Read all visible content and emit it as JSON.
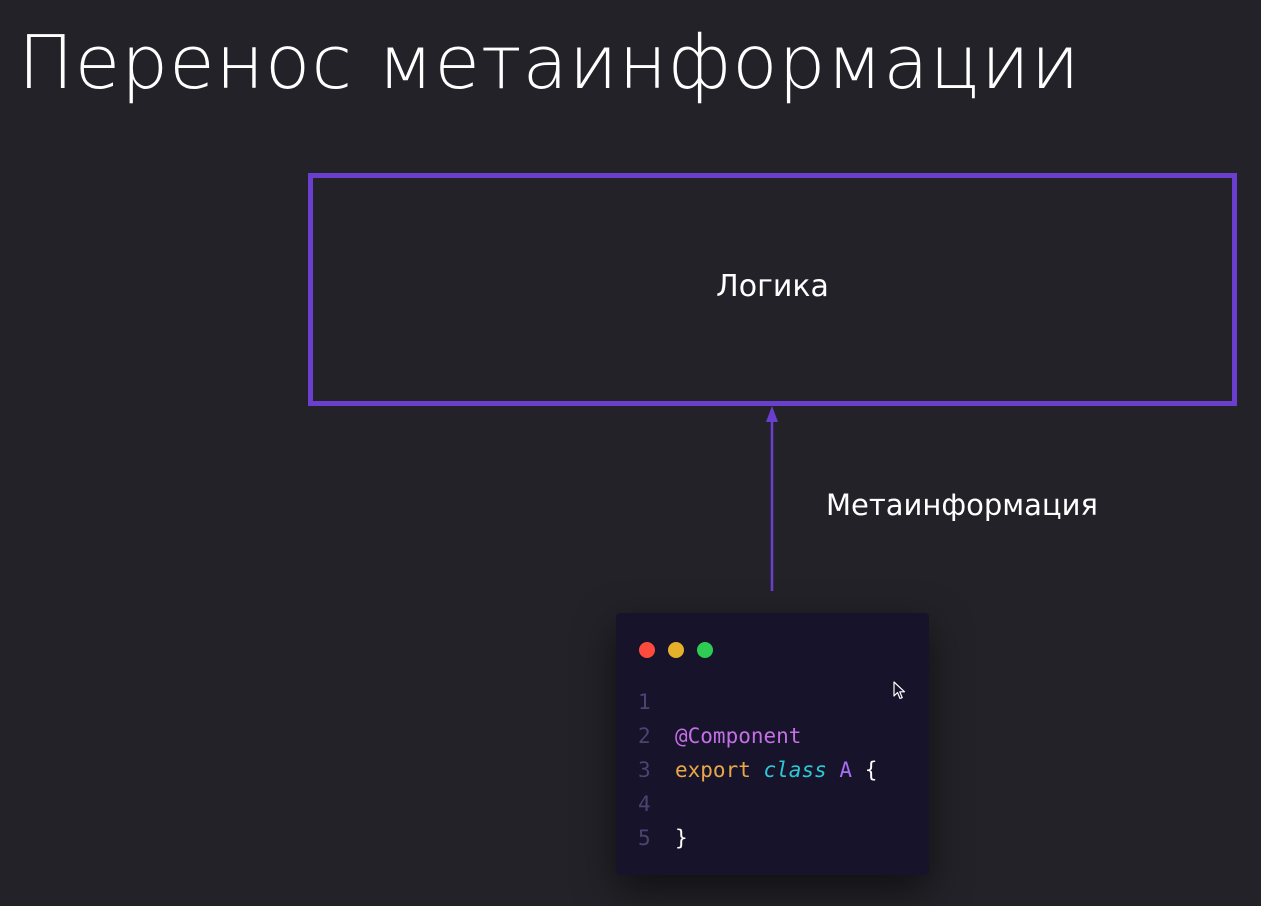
{
  "slide": {
    "title": "Перенос метаинформации"
  },
  "diagram": {
    "logic_box_label": "Логика",
    "arrow_label": "Метаинформация",
    "colors": {
      "accent": "#6a3fd0",
      "background": "#232228",
      "code_background": "#16132b"
    }
  },
  "code_window": {
    "dots": [
      {
        "name": "close",
        "color": "#ff4a3d"
      },
      {
        "name": "minimize",
        "color": "#e5b12a"
      },
      {
        "name": "maximize",
        "color": "#2ecc52"
      }
    ],
    "lines": [
      {
        "number": "1",
        "tokens": []
      },
      {
        "number": "2",
        "tokens": [
          {
            "text": "@Component",
            "kind": "decorator"
          }
        ]
      },
      {
        "number": "3",
        "tokens": [
          {
            "text": "export",
            "kind": "keyword"
          },
          {
            "text": " ",
            "kind": "punct"
          },
          {
            "text": "class",
            "kind": "type"
          },
          {
            "text": " ",
            "kind": "punct"
          },
          {
            "text": "A",
            "kind": "name"
          },
          {
            "text": " ",
            "kind": "punct"
          },
          {
            "text": "{",
            "kind": "punct"
          }
        ]
      },
      {
        "number": "4",
        "tokens": []
      },
      {
        "number": "5",
        "tokens": [
          {
            "text": "}",
            "kind": "punct"
          }
        ]
      }
    ]
  },
  "cursor": {
    "icon": "mouse-pointer-icon"
  }
}
